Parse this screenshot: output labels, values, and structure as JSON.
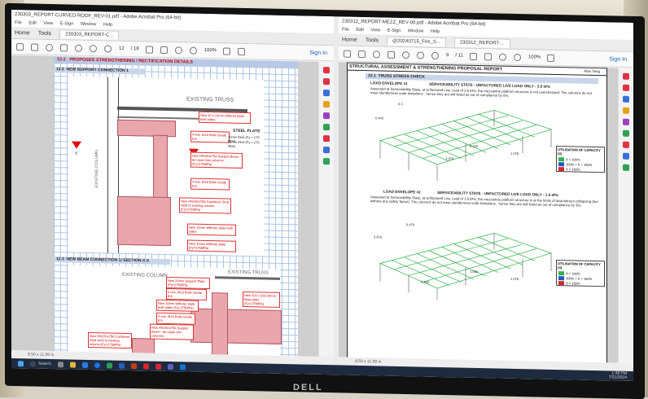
{
  "monitor": {
    "brand": "DELL"
  },
  "left_window": {
    "title": "230303_REPORT-CURVED ROOF_REV-01.pdf - Adobe Acrobat Pro (64-bit)",
    "menu": [
      "File",
      "Edit",
      "View",
      "E-Sign",
      "Window",
      "Help"
    ],
    "tabs": [
      "Home",
      "Tools",
      "230303_REPORT-C..."
    ],
    "page_current": "12",
    "page_total": "/ 18",
    "zoom": "100%",
    "sign_in": "Sign In",
    "status_size": "8.50 x 11.00 in",
    "page": {
      "section_title": "PROPOSED STRENGTHENING / RECTIFICATION DETAILS",
      "section_no": "12.2",
      "sub1_no": "12.2",
      "sub1": "NEW SUPPORT CONNECTION 1",
      "sub2_no": "12.3",
      "sub2": "NEW BEAM CONNECTION 1/ SECTION X-X",
      "existing_truss": "EXISTING TRUSS",
      "existing_column": "EXISTING COLUMN",
      "existing_truss2": "EXISTING TRUSS",
      "existing_column2": "EXISTING COLUMN",
      "steel_plate": "STEEL PLATE",
      "plate1": "10mm thick (Fy = 275 Mpa)",
      "plate2": "12mm thick (Fy = 275 Mpa)",
      "marker_x": "X",
      "notes": [
        "New 10 x 10mm stiffener plate both sides",
        "4 nos. M16 Bolts Grade 8.8",
        "New HN150x75A Support Beam - 6m span b/w columns (Fy=275MPa)",
        "4 nos. M16 Bolts Grade 8.8",
        "New HN150x75A Cantilever Stub weld to existing column (Fy=275MPa)",
        "New 10mm stiffener plate both sides",
        "New 10mm stiffener plate (Fy=275MPa)"
      ],
      "notes2": [
        "New 20mm Support Plate (Fy=275MPa)",
        "4 nos. M16 Bolts Grade 8.8",
        "New 10mm stiffener plate both sides (Fy=275MPa)",
        "4 nos. M16 Bolts Grade 8.8",
        "New HN150x75A Support Beam - 6m span b/w columns",
        "New HN150x75A Cantilever Stub weld to existing column (Fy=275MPa)",
        "New 200 x 200 20mm base plate (Fy=275MPa)"
      ]
    }
  },
  "right_window": {
    "title": "230312_REPORT-MEZZ_REV-00.pdf - Adobe Acrobat Pro (64-bit)",
    "menu": [
      "File",
      "Edit",
      "View",
      "E-Sign",
      "Window",
      "Help"
    ],
    "tabs": [
      "Home",
      "Tools",
      "@20240715_Fire_S...",
      "230312_REPORT-..."
    ],
    "page_current": "9",
    "page_total": "/ 11",
    "zoom": "100%",
    "sign_in": "Sign In",
    "status_size": "8.50 x 11.00 in",
    "page": {
      "header": "STRUCTURAL ASSESSMENT & STRENGTHENING PROPOSAL REPORT",
      "header_right": "Alan Teng",
      "section_no": "12.1",
      "section": "TRUSS STRESS CHECK",
      "load1": "LOAD ENVELOPE #1",
      "load1_state": "SERVICEABILITY STATE - UNFACTORED LIVE LOAD ONLY - 3.5 kPa",
      "load1_text": "Assessed at Serviceability State, at Unfactored Live Load of 3.5 kPa, the mezzanine platform structure is not overstressed. The columns do not meet slenderness code limitations - hence they are still listed as out of compliance by 8%.",
      "load2": "LOAD ENVELOPE #2",
      "load2_state": "SERVICEABILITY STATE - UNFACTORED LIVE LOAD ONLY - 1.5 kPa",
      "load2_text": "Assessed at Serviceability State, at Unfactored Live Load of 1.5 kPa, the mezzanine platform structure is at the limits of load without collapsing (but without any safety factor). The columns do not meet slenderness code limitations - hence they are still listed as out of compliance by 3%.",
      "legend_title": "UTILISATION OF CAPACITY (X)",
      "legend_title2": "UTILISATION OF CAPACITY (X)",
      "legend": [
        {
          "label": "X < 100%",
          "color": "#2fb34a"
        },
        {
          "label": "100% < X < 150%",
          "color": "#2456c9"
        },
        {
          "label": "X > 150%",
          "color": "#d8262c"
        }
      ],
      "labels1": [
        "0.3",
        "0.443",
        "0.315",
        "1.078",
        "1.078"
      ],
      "labels2": [
        "0.476",
        "0.416",
        "1.060",
        "0.430",
        "1.078"
      ]
    }
  },
  "taskbar": {
    "search": "Search",
    "time": "1:48 PM",
    "date": "7/31/2024"
  }
}
